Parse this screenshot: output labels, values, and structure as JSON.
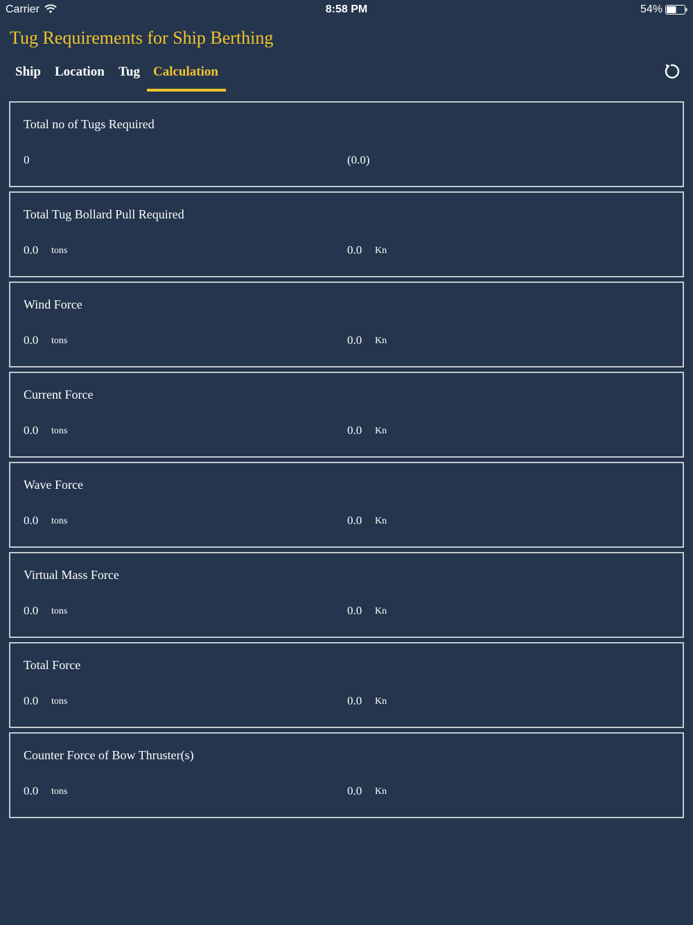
{
  "status_bar": {
    "carrier": "Carrier",
    "time": "8:58 PM",
    "battery_percent": "54%",
    "battery_level": 0.54
  },
  "app": {
    "title": "Tug Requirements for Ship Berthing"
  },
  "tabs": [
    {
      "label": "Ship",
      "active": false
    },
    {
      "label": "Location",
      "active": false
    },
    {
      "label": "Tug",
      "active": false
    },
    {
      "label": "Calculation",
      "active": true
    }
  ],
  "toolbar": {
    "refresh_icon": "refresh-icon"
  },
  "cards": [
    {
      "title": "Total no of Tugs Required",
      "left_value": "0",
      "left_unit": "",
      "right_value": "(0.0)",
      "right_unit": ""
    },
    {
      "title": "Total Tug Bollard Pull Required",
      "left_value": "0.0",
      "left_unit": "tons",
      "right_value": "0.0",
      "right_unit": "Kn"
    },
    {
      "title": "Wind Force",
      "left_value": "0.0",
      "left_unit": "tons",
      "right_value": "0.0",
      "right_unit": "Kn"
    },
    {
      "title": "Current Force",
      "left_value": "0.0",
      "left_unit": "tons",
      "right_value": "0.0",
      "right_unit": "Kn"
    },
    {
      "title": "Wave Force",
      "left_value": "0.0",
      "left_unit": "tons",
      "right_value": "0.0",
      "right_unit": "Kn"
    },
    {
      "title": "Virtual Mass Force",
      "left_value": "0.0",
      "left_unit": "tons",
      "right_value": "0.0",
      "right_unit": "Kn"
    },
    {
      "title": "Total Force",
      "left_value": "0.0",
      "left_unit": "tons",
      "right_value": "0.0",
      "right_unit": "Kn"
    },
    {
      "title": "Counter Force of Bow Thruster(s)",
      "left_value": "0.0",
      "left_unit": "tons",
      "right_value": "0.0",
      "right_unit": "Kn"
    }
  ],
  "colors": {
    "background": "#24354d",
    "accent": "#f2c32d",
    "border": "#c4c9d1",
    "text": "#ffffff"
  }
}
